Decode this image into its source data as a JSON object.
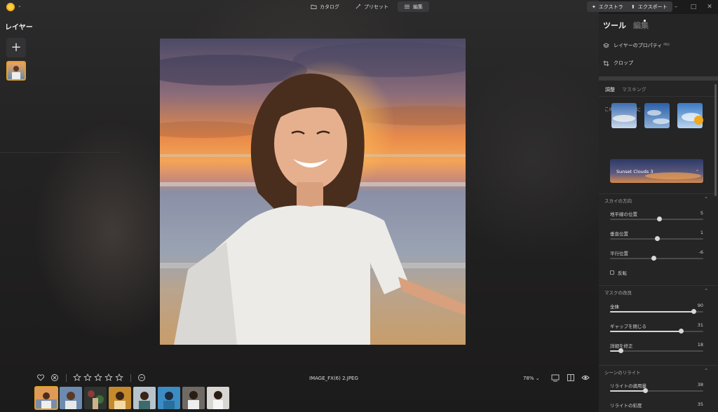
{
  "nav": {
    "catalog": "カタログ",
    "presets": "プリセット",
    "edit": "編集",
    "extra": "エクストラ",
    "export": "エクスポート"
  },
  "layers": {
    "title": "レイヤー",
    "add_label": "+"
  },
  "bottom": {
    "filename": "IMAGE_FX(6) 2.JPEG",
    "zoom": "78%",
    "rating_stars": 0,
    "rating_max": 5
  },
  "filmstrip_count": 8,
  "panel": {
    "tab_tools": "ツール",
    "tab_edit": "編集",
    "layer_properties": "レイヤーのプロパティ",
    "layer_properties_tag": "PRO",
    "crop": "クロップ",
    "subtab_adjust": "調整",
    "subtab_masking": "マスキング",
    "section_for_photo": "この写真のために",
    "selected_sky": "Sunset Clouds 3",
    "section_sky_direction": "スカイの方向",
    "horizon_label": "地平線の位置",
    "horizon_value": "5",
    "vertical_label": "垂直位置",
    "vertical_value": "1",
    "parallel_label": "平行位置",
    "parallel_value": "-6",
    "flip_label": "反転",
    "section_mask": "マスクの改良",
    "global_label": "全体",
    "global_value": "90",
    "gap_label": "ギャップを閉じる",
    "gap_value": "31",
    "detail_label": "詳細を修正",
    "detail_value": "18",
    "section_relight": "シーンのリライト",
    "relight_amount_label": "リライトの適用量",
    "relight_amount_value": "38",
    "relight_saturation_label": "リライトの彩度",
    "relight_saturation_value": "35"
  },
  "sliders": {
    "horizon": 0.53,
    "vertical": 0.51,
    "parallel": 0.47,
    "global": 0.9,
    "gap": 0.76,
    "detail": 0.12,
    "relight_amount": 0.38,
    "relight_saturation": 0.35
  },
  "colors": {
    "accent": "#e0a12a",
    "panel": "#252526"
  }
}
